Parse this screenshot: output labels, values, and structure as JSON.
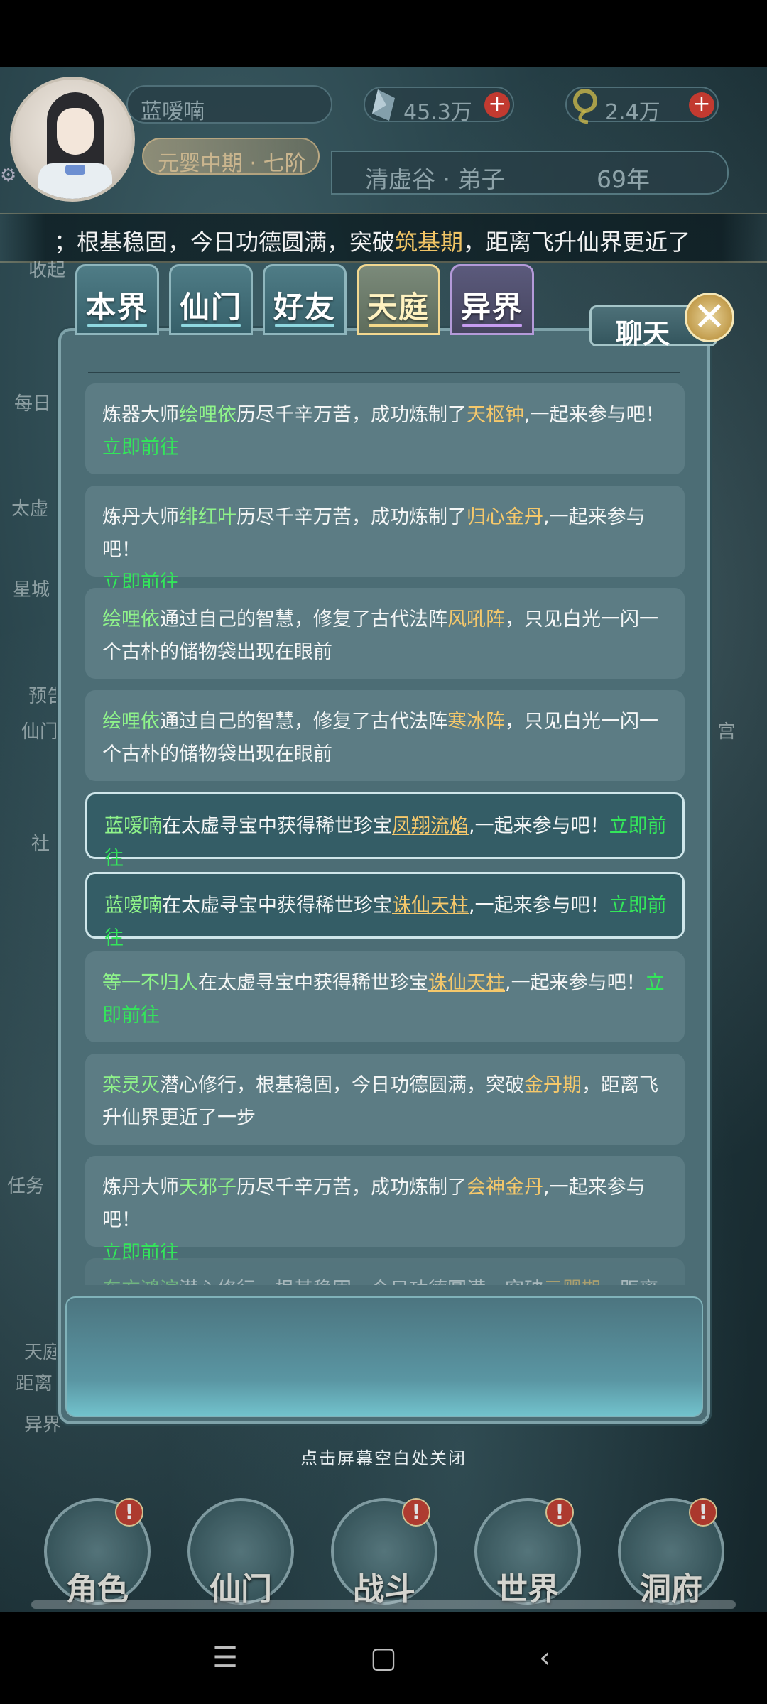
{
  "header": {
    "player_name": "蓝嗳喃",
    "realm": "元婴中期 · 七阶",
    "currency_1": "45.3万",
    "currency_2": "2.4万",
    "sect": "清虚谷 · 弟子",
    "age": "69年"
  },
  "marquee": {
    "prefix": "；根基稳固，今日功德圆满，突破",
    "highlight": "筑基期",
    "suffix": "，距离飞升仙界更近了"
  },
  "tabs": [
    {
      "label": "本界"
    },
    {
      "label": "仙门"
    },
    {
      "label": "好友"
    },
    {
      "label": "天庭"
    },
    {
      "label": "异界"
    }
  ],
  "chat_title": "聊天",
  "messages": [
    {
      "prefix": "炼器大师",
      "name": "绘哩依",
      "t1": "历尽千辛万苦，成功炼制了",
      "item": "天枢钟",
      "t2": ",一起来参与吧！",
      "go": "立即前往"
    },
    {
      "prefix": "炼丹大师",
      "name": "绯红叶",
      "t1": "历尽千辛万苦，成功炼制了",
      "item": "归心金丹",
      "t2": ",一起来参与吧！",
      "go": "立即前往"
    },
    {
      "name": "绘哩依",
      "t1": "通过自己的智慧，修复了古代法阵",
      "item": "风吼阵",
      "t2": "，只见白光一闪一个古朴的储物袋出现在眼前"
    },
    {
      "name": "绘哩依",
      "t1": "通过自己的智慧，修复了古代法阵",
      "item": "寒冰阵",
      "t2": "，只见白光一闪一个古朴的储物袋出现在眼前"
    },
    {
      "name": "蓝嗳喃",
      "t1": "在太虚寻宝中获得稀世珍宝",
      "item": "凤翔流焰",
      "t2": ",一起来参与吧！",
      "go": "立即前往"
    },
    {
      "name": "蓝嗳喃",
      "t1": "在太虚寻宝中获得稀世珍宝",
      "item": "诛仙天柱",
      "t2": ",一起来参与吧！",
      "go": "立即前往"
    },
    {
      "name": "等一不归人",
      "t1": "在太虚寻宝中获得稀世珍宝",
      "item": "诛仙天柱",
      "t2": ",一起来参与吧！",
      "go": "立即前往"
    },
    {
      "name": "栾灵灭",
      "t1": "潜心修行，根基稳固，今日功德圆满，突破",
      "item": "金丹期",
      "t2": "，距离飞升仙界更近了一步"
    },
    {
      "prefix": "炼丹大师",
      "name": "天邪子",
      "t1": "历尽千辛万苦，成功炼制了",
      "item": "会神金丹",
      "t2": ",一起来参与吧！",
      "go": "立即前往"
    },
    {
      "name": "东方鸿滨",
      "t1": "潜心修行，根基稳固，今日功德圆满，突破",
      "item": "元婴期",
      "t2": "，距离飞升"
    }
  ],
  "close_hint": "点击屏幕空白处关闭",
  "bottom_nav": [
    {
      "label": "角色",
      "badge": "!"
    },
    {
      "label": "仙门",
      "badge": ""
    },
    {
      "label": "战斗",
      "badge": "!"
    },
    {
      "label": "世界",
      "badge": "!"
    },
    {
      "label": "洞府",
      "badge": "!"
    }
  ],
  "side_labels": [
    "收起",
    "每日",
    "太虚",
    "星城",
    "预告",
    "仙门",
    "社",
    "任务",
    "天庭",
    "距离",
    "异界",
    "宫"
  ],
  "system_nav": {
    "menu_icon": "menu-icon",
    "home_icon": "square-icon",
    "back_icon": "back-chevron-icon"
  }
}
